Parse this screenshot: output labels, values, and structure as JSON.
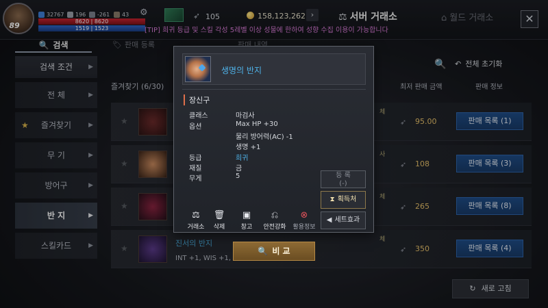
{
  "hud": {
    "level": "89",
    "stat_power": "32767",
    "stat_attack": "196",
    "stat_defense": "-261",
    "stat_misc": "43",
    "hp": "8620 | 8620",
    "mp": "1519 | 1523",
    "feather_count": "105",
    "gold": "158,123,262",
    "server_title": "서버 거래소",
    "world_title": "월드 거래소",
    "notice": "[TIP] 희귀 등급 및 스킬 각성 5레벨 이상 성물에 한하여 성향 수집 이용이 가능합니다"
  },
  "tabs": {
    "search": "검색",
    "register": "판매 등록",
    "third": "판매 내역"
  },
  "sidebar": {
    "header": "검색 조건",
    "items": [
      {
        "label": "전 체"
      },
      {
        "label": "즐겨찾기"
      },
      {
        "label": "무 기"
      },
      {
        "label": "방어구"
      },
      {
        "label": "반 지"
      },
      {
        "label": "스킬카드"
      }
    ]
  },
  "list": {
    "reset_all": "전체 초기화",
    "fav_count": "즐겨찾기 (6/30)",
    "col_price": "최저 판매 금액",
    "col_info": "판매 정보",
    "rows": [
      {
        "price": "95.00",
        "button": "판매 목록 (1)"
      },
      {
        "price": "108",
        "button": "판매 목록 (3)"
      },
      {
        "price": "265",
        "button": "판매 목록 (8)"
      },
      {
        "price": "350",
        "button": "판매 목록 (4)"
      }
    ],
    "row4_name": "진서의 반지",
    "row4_stats": "INT +1, WIS +1, M",
    "refresh": "새로 고침"
  },
  "tooltip": {
    "item_name": "생명의 반지",
    "category": "장신구",
    "fields": {
      "class_label": "클래스",
      "class_value": "마검사",
      "option_label": "옵션",
      "option_1": "Max HP +30",
      "option_2": "물리 방어력(AC) -1",
      "option_3": "생명 +1",
      "grade_label": "등급",
      "grade_value": "희귀",
      "material_label": "재질",
      "material_value": "금",
      "weight_label": "무게",
      "weight_value": "5"
    },
    "actions": {
      "exchange": "거래소",
      "delete": "삭제",
      "storage": "창고",
      "enhance": "안전강화",
      "usage": "활용정보"
    },
    "side_buttons": {
      "register_line1": "등 록",
      "register_line2": "(-)",
      "obtain": "획득처",
      "set_effect": "세트효과"
    },
    "compare": "비 교"
  },
  "colors": {
    "accent_blue": "#4fb2e8",
    "price_gold": "#e7c06a",
    "notice_pink": "#d77ad6"
  }
}
